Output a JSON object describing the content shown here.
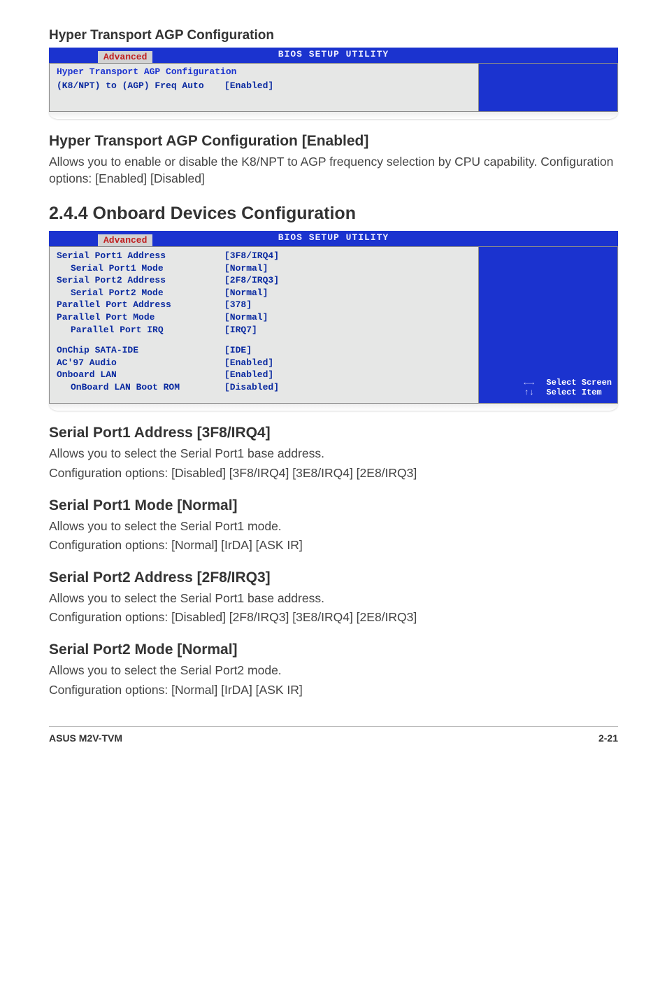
{
  "sec_ht": {
    "title": "Hyper Transport AGP Configuration",
    "bios": {
      "top_title": "BIOS SETUP UTILITY",
      "tab": "Advanced",
      "subtitle": "Hyper Transport AGP Configuration",
      "rows": [
        {
          "label": "(K8/NPT) to (AGP) Freq Auto",
          "value": "[Enabled]"
        }
      ]
    },
    "opt_head": "Hyper Transport AGP Configuration [Enabled]",
    "opt_p1": "Allows you to enable or disable the K8/NPT to AGP frequency selection by CPU capability. Configuration options: [Enabled] [Disabled]"
  },
  "sec_onboard": {
    "num_title": "2.4.4   Onboard Devices Configuration",
    "bios": {
      "top_title": "BIOS SETUP UTILITY",
      "tab": "Advanced",
      "group1": [
        {
          "label": "Serial Port1 Address",
          "value": "[3F8/IRQ4]",
          "indent": false
        },
        {
          "label": "Serial Port1 Mode",
          "value": "[Normal]",
          "indent": true
        },
        {
          "label": "Serial Port2 Address",
          "value": "[2F8/IRQ3]",
          "indent": false
        },
        {
          "label": "Serial Port2 Mode",
          "value": "[Normal]",
          "indent": true
        },
        {
          "label": "Parallel Port Address",
          "value": "[378]",
          "indent": false
        },
        {
          "label": "Parallel Port Mode",
          "value": "[Normal]",
          "indent": false
        },
        {
          "label": "Parallel Port IRQ",
          "value": "[IRQ7]",
          "indent": true
        }
      ],
      "group2": [
        {
          "label": "OnChip SATA-IDE",
          "value": "[IDE]"
        },
        {
          "label": "AC'97 Audio",
          "value": "[Enabled]"
        },
        {
          "label": "Onboard LAN",
          "value": "[Enabled]"
        },
        {
          "label": "OnBoard LAN Boot ROM",
          "value": "[Disabled]",
          "indent": true
        }
      ],
      "legend": [
        {
          "key": "←→",
          "txt": "Select Screen"
        },
        {
          "key": "↑↓",
          "txt": "Select Item"
        }
      ]
    }
  },
  "opts": {
    "sp1a": {
      "h": "Serial Port1 Address [3F8/IRQ4]",
      "p1": "Allows you to select the Serial Port1 base address.",
      "p2": "Configuration options: [Disabled] [3F8/IRQ4] [3E8/IRQ4] [2E8/IRQ3]"
    },
    "sp1m": {
      "h": "Serial Port1 Mode [Normal]",
      "p1": "Allows you to select the Serial Port1 mode.",
      "p2": "Configuration options: [Normal] [IrDA] [ASK IR]"
    },
    "sp2a": {
      "h": "Serial Port2 Address [2F8/IRQ3]",
      "p1": "Allows you to select the Serial Port1 base address.",
      "p2": "Configuration options: [Disabled] [2F8/IRQ3] [3E8/IRQ4] [2E8/IRQ3]"
    },
    "sp2m": {
      "h": "Serial Port2 Mode [Normal]",
      "p1": "Allows you to select the Serial Port2 mode.",
      "p2": "Configuration options: [Normal] [IrDA] [ASK IR]"
    }
  },
  "footer": {
    "left": "ASUS M2V-TVM",
    "right": "2-21"
  }
}
